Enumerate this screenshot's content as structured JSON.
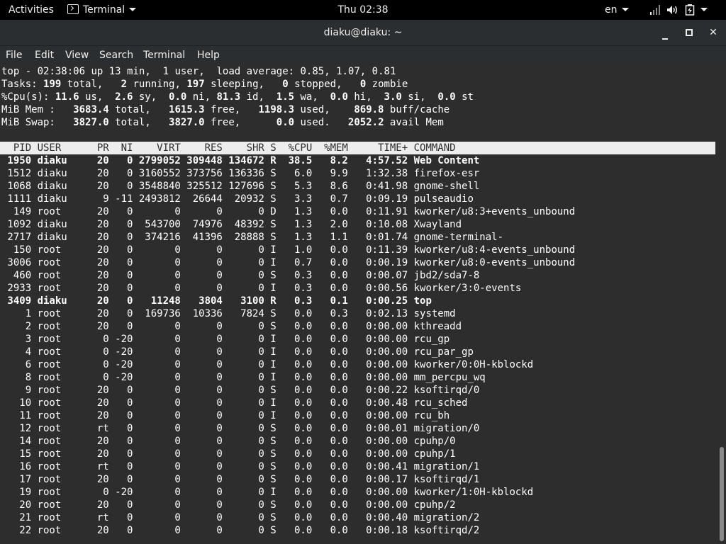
{
  "topbar": {
    "activities": "Activities",
    "app_name": "Terminal",
    "clock": "Thu 02:38",
    "language": "en",
    "icons": [
      "network-icon",
      "volume-icon",
      "battery-icon",
      "power-menu-icon"
    ]
  },
  "window": {
    "title": "diaku@diaku: ~"
  },
  "menu": [
    "File",
    "Edit",
    "View",
    "Search",
    "Terminal",
    "Help"
  ],
  "terminal": {
    "summary": [
      "top - 02:38:06 up 13 min,  1 user,  load average: 0.85, 1.07, 0.81",
      "Tasks: 199 total,   2 running, 197 sleeping,   0 stopped,   0 zombie",
      "%Cpu(s): 11.6 us,  2.6 sy,  0.0 ni, 81.3 id,  1.5 wa,  0.0 hi,  3.0 si,  0.0 st",
      "MiB Mem :   3683.4 total,   1615.3 free,   1198.3 used,    869.8 buff/cache",
      "MiB Swap:   3827.0 total,   3827.0 free,      0.0 used.   2052.2 avail Mem"
    ],
    "header": "  PID USER      PR  NI    VIRT    RES    SHR S  %CPU  %MEM     TIME+ COMMAND",
    "processes": [
      {
        "text": " 1950 diaku     20   0 2799052 309448 134672 R  38.5   8.2   4:57.52 Web Content",
        "bold": true
      },
      {
        "text": " 1512 diaku     20   0 3160552 373756 136336 S   6.0   9.9   1:32.38 firefox-esr",
        "bold": false
      },
      {
        "text": " 1068 diaku     20   0 3548840 325512 127696 S   5.3   8.6   0:41.98 gnome-shell",
        "bold": false
      },
      {
        "text": " 1111 diaku      9 -11 2493812  26644  20932 S   3.3   0.7   0:09.19 pulseaudio",
        "bold": false
      },
      {
        "text": "  149 root      20   0       0      0      0 D   1.3   0.0   0:11.91 kworker/u8:3+events_unbound",
        "bold": false
      },
      {
        "text": " 1092 diaku     20   0  543700  74976  48392 S   1.3   2.0   0:10.08 Xwayland",
        "bold": false
      },
      {
        "text": " 2717 diaku     20   0  374216  41396  28888 S   1.3   1.1   0:01.74 gnome-terminal-",
        "bold": false
      },
      {
        "text": "  150 root      20   0       0      0      0 I   1.0   0.0   0:11.39 kworker/u8:4-events_unbound",
        "bold": false
      },
      {
        "text": " 3006 root      20   0       0      0      0 I   0.7   0.0   0:00.19 kworker/u8:0-events_unbound",
        "bold": false
      },
      {
        "text": "  460 root      20   0       0      0      0 S   0.3   0.0   0:00.07 jbd2/sda7-8",
        "bold": false
      },
      {
        "text": " 2933 root      20   0       0      0      0 I   0.3   0.0   0:00.56 kworker/3:0-events",
        "bold": false
      },
      {
        "text": " 3409 diaku     20   0   11248   3804   3100 R   0.3   0.1   0:00.25 top",
        "bold": true
      },
      {
        "text": "    1 root      20   0  169736  10336   7824 S   0.0   0.3   0:02.13 systemd",
        "bold": false
      },
      {
        "text": "    2 root      20   0       0      0      0 S   0.0   0.0   0:00.00 kthreadd",
        "bold": false
      },
      {
        "text": "    3 root       0 -20       0      0      0 I   0.0   0.0   0:00.00 rcu_gp",
        "bold": false
      },
      {
        "text": "    4 root       0 -20       0      0      0 I   0.0   0.0   0:00.00 rcu_par_gp",
        "bold": false
      },
      {
        "text": "    6 root       0 -20       0      0      0 I   0.0   0.0   0:00.00 kworker/0:0H-kblockd",
        "bold": false
      },
      {
        "text": "    8 root       0 -20       0      0      0 I   0.0   0.0   0:00.00 mm_percpu_wq",
        "bold": false
      },
      {
        "text": "    9 root      20   0       0      0      0 S   0.0   0.0   0:00.22 ksoftirqd/0",
        "bold": false
      },
      {
        "text": "   10 root      20   0       0      0      0 I   0.0   0.0   0:00.48 rcu_sched",
        "bold": false
      },
      {
        "text": "   11 root      20   0       0      0      0 I   0.0   0.0   0:00.00 rcu_bh",
        "bold": false
      },
      {
        "text": "   12 root      rt   0       0      0      0 S   0.0   0.0   0:00.01 migration/0",
        "bold": false
      },
      {
        "text": "   14 root      20   0       0      0      0 S   0.0   0.0   0:00.00 cpuhp/0",
        "bold": false
      },
      {
        "text": "   15 root      20   0       0      0      0 S   0.0   0.0   0:00.00 cpuhp/1",
        "bold": false
      },
      {
        "text": "   16 root      rt   0       0      0      0 S   0.0   0.0   0:00.41 migration/1",
        "bold": false
      },
      {
        "text": "   17 root      20   0       0      0      0 S   0.0   0.0   0:00.17 ksoftirqd/1",
        "bold": false
      },
      {
        "text": "   19 root       0 -20       0      0      0 I   0.0   0.0   0:00.00 kworker/1:0H-kblockd",
        "bold": false
      },
      {
        "text": "   20 root      20   0       0      0      0 S   0.0   0.0   0:00.00 cpuhp/2",
        "bold": false
      },
      {
        "text": "   21 root      rt   0       0      0      0 S   0.0   0.0   0:00.40 migration/2",
        "bold": false
      },
      {
        "text": "   22 root      20   0       0      0      0 S   0.0   0.0   0:00.18 ksoftirqd/2",
        "bold": false
      }
    ]
  }
}
